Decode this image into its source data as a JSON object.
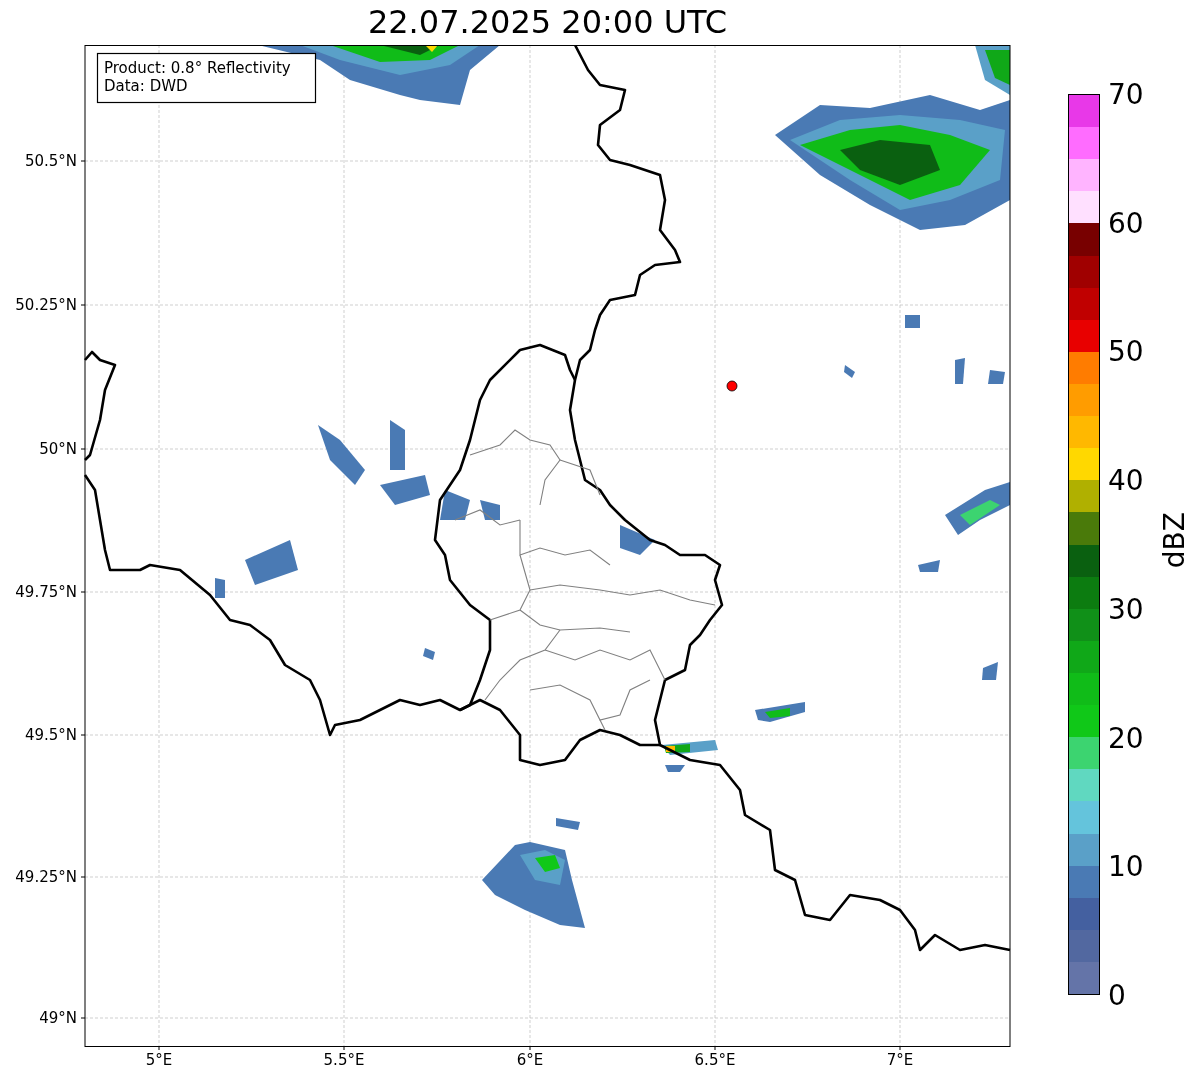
{
  "title": "22.07.2025 20:00 UTC",
  "map": {
    "info_lines": [
      "Product: 0.8° Reflectivity",
      "Data: DWD"
    ],
    "lat_ticks": [
      "50.5°N",
      "50.25°N",
      "50°N",
      "49.75°N",
      "49.5°N",
      "49.25°N",
      "49°N"
    ],
    "lon_ticks": [
      "5°E",
      "5.5°E",
      "6°E",
      "6.5°E",
      "7°E"
    ]
  },
  "colorbar": {
    "label": "dBZ",
    "ticks": [
      "70",
      "60",
      "50",
      "40",
      "30",
      "20",
      "10",
      "0"
    ],
    "bins": [
      {
        "color": "#e838e8"
      },
      {
        "color": "#ff6cff"
      },
      {
        "color": "#ffb4ff"
      },
      {
        "color": "#ffe0ff"
      },
      {
        "color": "#780000"
      },
      {
        "color": "#a00000"
      },
      {
        "color": "#c00000"
      },
      {
        "color": "#e80000"
      },
      {
        "color": "#ff7c00"
      },
      {
        "color": "#ff9c00"
      },
      {
        "color": "#ffb800"
      },
      {
        "color": "#ffd800"
      },
      {
        "color": "#b0b000"
      },
      {
        "color": "#4a7a0a"
      },
      {
        "color": "#0a6010"
      },
      {
        "color": "#0c7c10"
      },
      {
        "color": "#109018"
      },
      {
        "color": "#10a818"
      },
      {
        "color": "#10bc18"
      },
      {
        "color": "#10c818"
      },
      {
        "color": "#3cd470"
      },
      {
        "color": "#60d8c0"
      },
      {
        "color": "#64c4dc"
      },
      {
        "color": "#5aa0c8"
      },
      {
        "color": "#4a7ab4"
      },
      {
        "color": "#4460a0"
      },
      {
        "color": "#5268a0"
      },
      {
        "color": "#6474a8"
      }
    ]
  }
}
